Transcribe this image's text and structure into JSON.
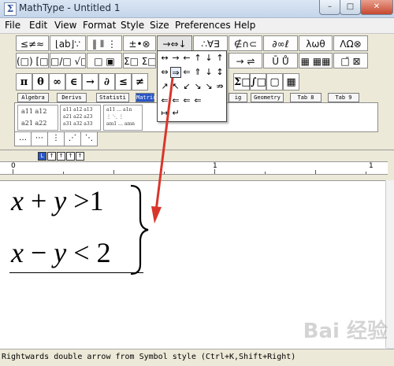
{
  "window": {
    "title": "MathType - Untitled 1",
    "controls": [
      "–",
      "□",
      "✕"
    ]
  },
  "menu": [
    "File",
    "Edit",
    "View",
    "Format",
    "Style",
    "Size",
    "Preferences",
    "Help"
  ],
  "symbol_row1": [
    "≤≠≈",
    "⌊ab⌋∵",
    "‖ ⦀ ⋮",
    "±•⊗",
    "→⇔↓",
    "∴∀∃",
    "∉∩⊂",
    "∂∞ℓ",
    "λωθ",
    "ΛΩ⊗"
  ],
  "symbol_row2": [
    "(□) [□]",
    "□/□ √□",
    "□ ▣",
    "Σ□ Σ□",
    "∫□ ∮□",
    "□̄ □⃗",
    "→ ⇌",
    "Ū Ů",
    "▦ ▦▦",
    "□̄ ⊠"
  ],
  "small_row": [
    "π",
    "θ",
    "∞",
    "∈",
    "→",
    "∂",
    "≤",
    "≠"
  ],
  "small_row_right": [
    "Σ□",
    "∫□",
    "▢",
    "▦"
  ],
  "tabs": [
    "Algebra",
    "Derivs",
    "Statisti",
    "Matrices",
    "ig",
    "Geometry",
    "Tab 8",
    "Tab 9"
  ],
  "templates": [
    [
      "a11 a12",
      "a21 a22"
    ],
    [
      "a11 a12 a13",
      "a21 a22 a23",
      "a31 a32 a33"
    ],
    [
      "a11 … a1n",
      "⋮ ⋱ ⋮",
      "am1 … amn"
    ]
  ],
  "dots": [
    "…",
    "⋯",
    "⋮",
    "⋰",
    "⋱"
  ],
  "arrow_palette": [
    "⇔",
    "⇒",
    "⇐",
    "⇑",
    "↓",
    "↕",
    "↗",
    "↖",
    "↙",
    "↘",
    "↘",
    "⇏",
    "⇐",
    "⇐",
    "⇐",
    "⇐",
    "↦",
    "↵"
  ],
  "arrow_palette_top": [
    "↔",
    "→",
    "←",
    "↑",
    "↓",
    "↑"
  ],
  "ruler_buttons": [
    "L",
    "↑",
    "↑",
    "↑",
    "↑"
  ],
  "ruler_numbers": [
    "0",
    "1",
    "1"
  ],
  "equation": {
    "line1": {
      "a": "x",
      "op1": "+",
      "b": "y",
      "op2": ">",
      "c": "1"
    },
    "line2": {
      "a": "x",
      "op1": "−",
      "b": "y",
      "op2": "<",
      "c": "2"
    }
  },
  "status": "Rightwards double arrow from Symbol style (Ctrl+K,Shift+Right)",
  "watermark": "Bai 经验",
  "accent_color": "#2a56c6",
  "arrow_color": "#d9362b"
}
